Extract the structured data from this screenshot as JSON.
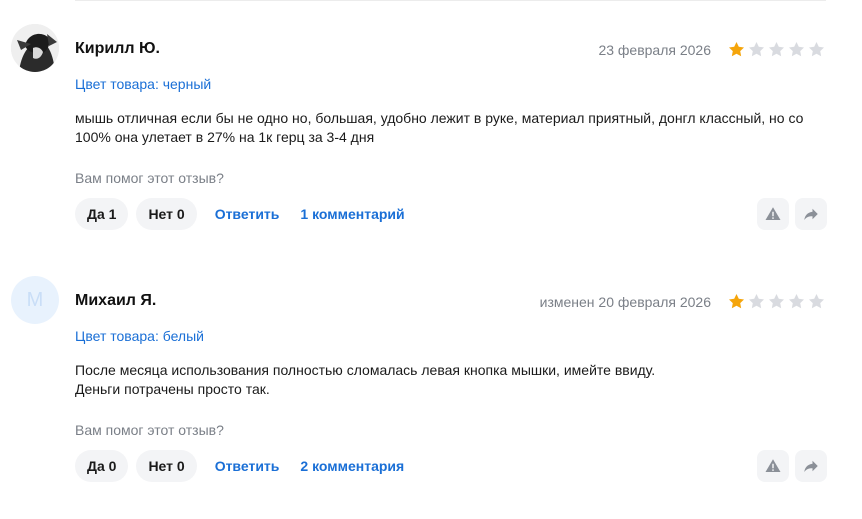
{
  "reviews": [
    {
      "author": "Кирилл Ю.",
      "avatar_letter": "",
      "date": "23 февраля 2026",
      "rating": 1,
      "max_rating": 5,
      "variant": "Цвет товара: черный",
      "text_lines": [
        "мышь отличная если бы не одно но, большая, удобно лежит в руке, материал приятный, донгл классный, но со",
        "100% она улетает в 27% на 1к герц за 3-4 дня"
      ],
      "helpful_question": "Вам помог этот отзыв?",
      "yes_label": "Да 1",
      "no_label": "Нет 0",
      "reply_label": "Ответить",
      "comments_label": "1 комментарий"
    },
    {
      "author": "Михаил Я.",
      "avatar_letter": "М",
      "date": "изменен 20 февраля 2026",
      "rating": 1,
      "max_rating": 5,
      "variant": "Цвет товара: белый",
      "text_lines": [
        "После месяца использования полностью сломалась левая кнопка мышки, имейте ввиду.",
        "Деньги потрачены просто так."
      ],
      "helpful_question": "Вам помог этот отзыв?",
      "yes_label": "Да 0",
      "no_label": "Нет 0",
      "reply_label": "Ответить",
      "comments_label": "2 комментария"
    }
  ],
  "icons": {
    "report": "warning-icon",
    "share": "share-arrow-icon",
    "star_filled_color": "#f5a50b",
    "star_empty_color": "#d9dbe0",
    "accent": "#1a6fd6"
  }
}
